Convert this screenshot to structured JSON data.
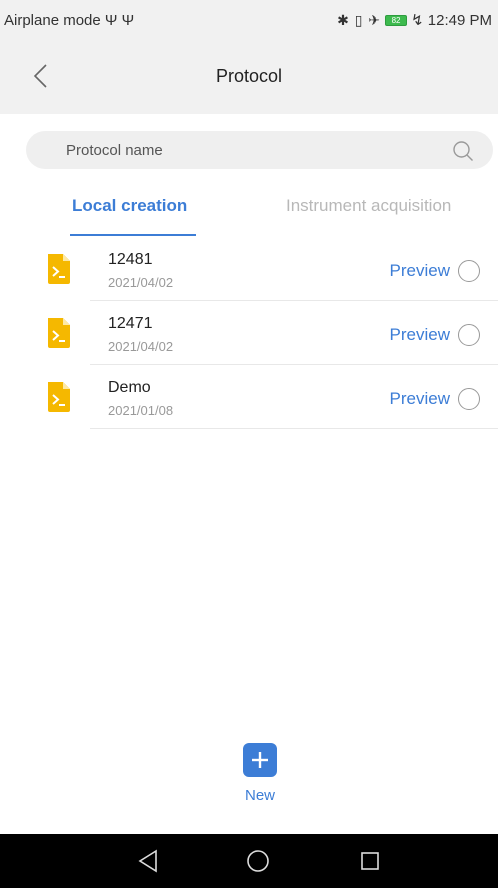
{
  "status_bar": {
    "left_text": "Airplane mode Ψ Ψ",
    "icons": "✱ ▯ ✈",
    "battery": "82",
    "time": "↯ 12:49 PM"
  },
  "header": {
    "title": "Protocol",
    "back_icon": "chevron-left-icon"
  },
  "search": {
    "placeholder": "Protocol name",
    "icon": "search-icon"
  },
  "tabs": [
    {
      "label": "Local creation",
      "active": true
    },
    {
      "label": "Instrument acquisition",
      "active": false
    }
  ],
  "protocols": [
    {
      "name": "12481",
      "date": "2021/04/02",
      "action": "Preview"
    },
    {
      "name": "12471",
      "date": "2021/04/02",
      "action": "Preview"
    },
    {
      "name": "Demo",
      "date": "2021/01/08",
      "action": "Preview"
    }
  ],
  "new_button": {
    "label": "New",
    "icon": "plus-icon"
  },
  "nav_bar": {
    "icons": [
      "back-triangle-icon",
      "home-circle-icon",
      "recents-square-icon"
    ]
  },
  "colors": {
    "accent": "#3c7dd6",
    "file_icon": "#f5b800",
    "header_bg": "#f1f1f1",
    "nav_bg": "#000000"
  }
}
